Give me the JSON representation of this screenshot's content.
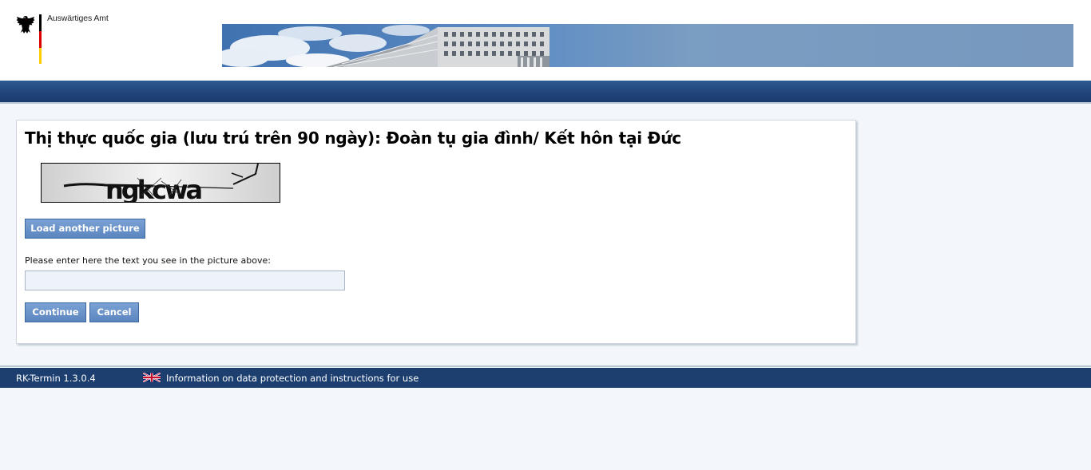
{
  "header": {
    "ministry_name": "Auswärtiges Amt",
    "flag_colors": [
      "#000000",
      "#dd0000",
      "#ffce00"
    ],
    "icons": {
      "logo": "federal-eagle-icon"
    }
  },
  "main": {
    "title": "Thị thực quốc gia (lưu trú trên 90 ngày): Đoàn tụ gia đình/ Kết hôn tại Đức",
    "captcha_text": "ngkcwa",
    "reload_button_label": "Load another picture",
    "prompt_label": "Please enter here the text you see in the picture above:",
    "captcha_input_value": "",
    "captcha_input_placeholder": "",
    "continue_label": "Continue",
    "cancel_label": "Cancel"
  },
  "footer": {
    "version": "RK-Termin 1.3.0.4",
    "privacy_link": "Information on data protection and instructions for use",
    "icons": {
      "language": "uk-flag-icon"
    }
  },
  "colors": {
    "nav_blue": "#1f4478",
    "button_blue": "#5b85bf",
    "page_background": "#f3f7fc"
  }
}
